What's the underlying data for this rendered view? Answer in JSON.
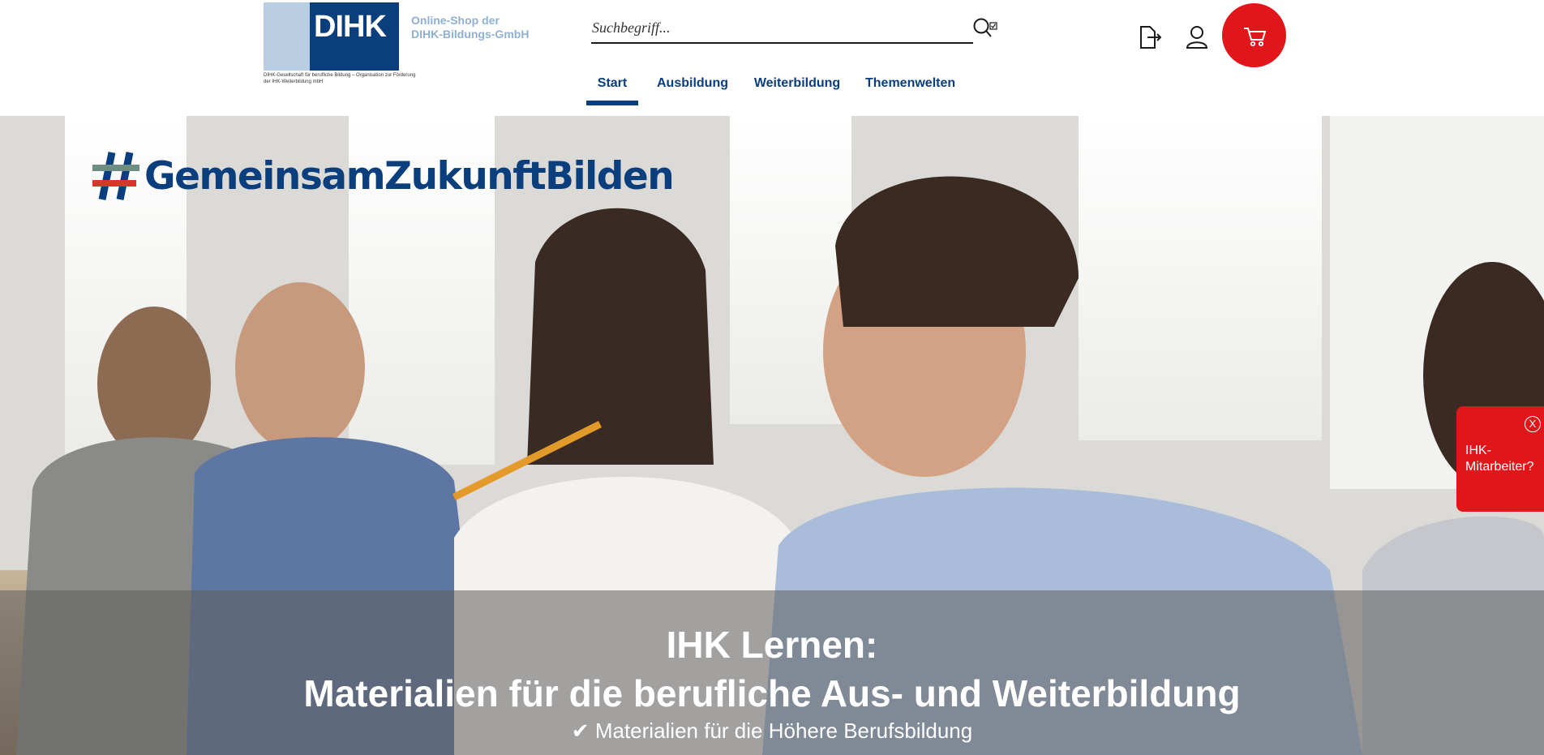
{
  "header": {
    "logo_text": "DIHK",
    "logo_subtitle": "DIHK-Gesellschaft für berufliche Bildung – Organisation zur Förderung der IHK-Weiterbildung mbH",
    "shop_line1": "Online-Shop der",
    "shop_line2": "DIHK-Bildungs-GmbH",
    "search_placeholder": "Suchbegriff...",
    "icons": [
      "search-icon",
      "login-icon",
      "user-icon",
      "cart-icon"
    ],
    "nav": [
      {
        "label": "Start",
        "active": true
      },
      {
        "label": "Ausbildung",
        "active": false
      },
      {
        "label": "Weiterbildung",
        "active": false
      },
      {
        "label": "Themenwelten",
        "active": false
      }
    ]
  },
  "hero": {
    "hashtag": "GemeinsamZukunftBilden",
    "title_line1": "IHK Lernen:",
    "title_line2": "Materialien für die berufliche Aus- und Weiterbildung",
    "check_item": "Materialien für die Höhere Berufsbildung"
  },
  "flyout": {
    "close_label": "X",
    "text": "IHK-Mitarbeiter?"
  },
  "colors": {
    "brand_blue": "#0a3e7c",
    "light_blue": "#b9cde3",
    "accent_red": "#e0161b"
  }
}
